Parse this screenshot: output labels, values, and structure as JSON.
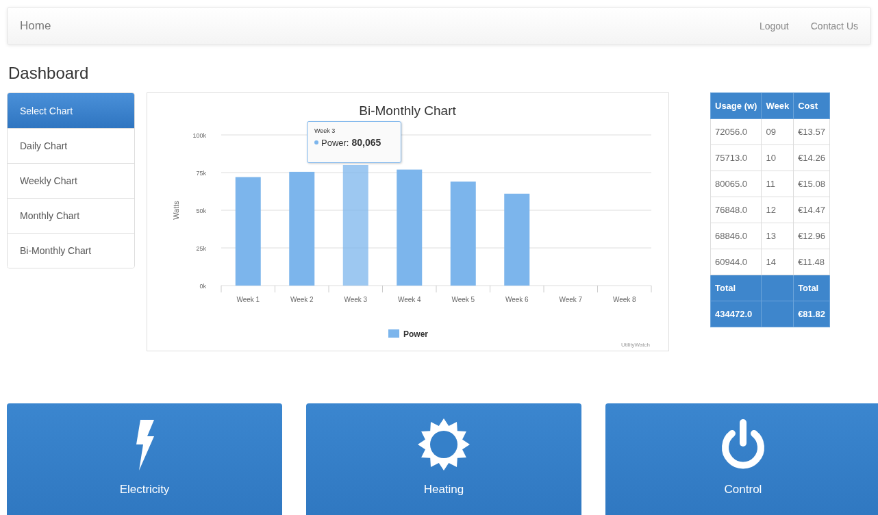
{
  "navbar": {
    "brand": "Home",
    "links": [
      "Logout",
      "Contact Us"
    ]
  },
  "page_title": "Dashboard",
  "sidebar": {
    "items": [
      {
        "label": "Select Chart",
        "selected": true
      },
      {
        "label": "Daily Chart",
        "selected": false
      },
      {
        "label": "Weekly Chart",
        "selected": false
      },
      {
        "label": "Monthly Chart",
        "selected": false
      },
      {
        "label": "Bi-Monthly Chart",
        "selected": false
      }
    ]
  },
  "chart": {
    "chart_data": {
      "type": "bar",
      "title": "Bi-Monthly Chart",
      "ylabel": "Watts",
      "categories": [
        "Week 1",
        "Week 2",
        "Week 3",
        "Week 4",
        "Week 5",
        "Week 6",
        "Week 7",
        "Week 8"
      ],
      "series": [
        {
          "name": "Power",
          "color": "#7cb5ec",
          "values": [
            72000,
            75500,
            80000,
            77000,
            69000,
            61000,
            null,
            null
          ]
        }
      ],
      "grid": true,
      "ylim": [
        0,
        100000
      ],
      "yticks": [
        {
          "value": 0,
          "label": "0k"
        },
        {
          "value": 25000,
          "label": "25k"
        },
        {
          "value": 50000,
          "label": "50k"
        },
        {
          "value": 75000,
          "label": "75k"
        },
        {
          "value": 100000,
          "label": "100k"
        }
      ]
    },
    "tooltip": {
      "title": "Week 3",
      "series": "Power:",
      "value": "80,065"
    },
    "credit": "UtilityWatch"
  },
  "table": {
    "columns": [
      "Usage (w)",
      "Week",
      "Cost"
    ],
    "rows": [
      [
        "72056.0",
        "09",
        "€13.57"
      ],
      [
        "75713.0",
        "10",
        "€14.26"
      ],
      [
        "80065.0",
        "11",
        "€15.08"
      ],
      [
        "76848.0",
        "12",
        "€14.47"
      ],
      [
        "68846.0",
        "13",
        "€12.96"
      ],
      [
        "60944.0",
        "14",
        "€11.48"
      ]
    ],
    "footer": [
      {
        "usage": "Total",
        "cost": "Total"
      },
      {
        "usage": "434472.0",
        "cost": "€81.82"
      }
    ]
  },
  "tiles": [
    {
      "kind": "lightning",
      "label": "Electricity"
    },
    {
      "kind": "sun",
      "label": "Heating"
    },
    {
      "kind": "power",
      "label": "Control"
    }
  ]
}
